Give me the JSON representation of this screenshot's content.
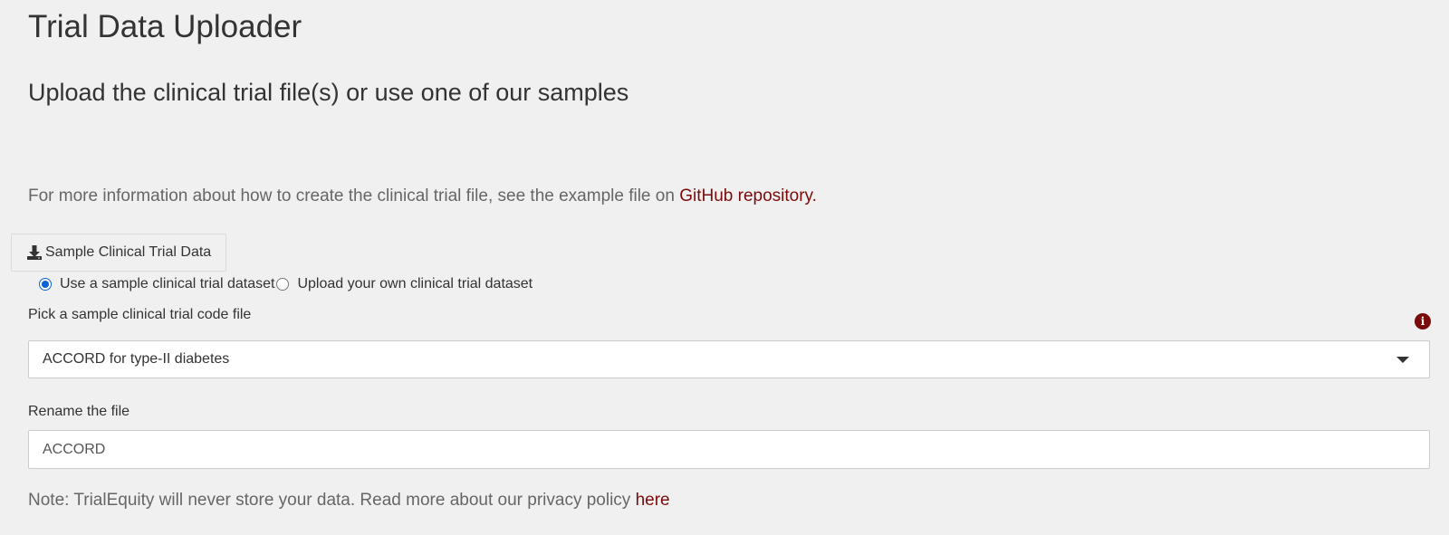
{
  "header": {
    "title": "Trial Data Uploader",
    "subtitle": "Upload the clinical trial file(s) or use one of our samples"
  },
  "info": {
    "text": "For more information about how to create the clinical trial file, see the example file on ",
    "link_text": "GitHub repository."
  },
  "download_button": {
    "label": "Sample Clinical Trial Data",
    "icon": "download-icon"
  },
  "dataset_choice": {
    "options": [
      {
        "label": "Use a sample clinical trial dataset",
        "checked": true
      },
      {
        "label": "Upload your own clinical trial dataset",
        "checked": false
      }
    ]
  },
  "sample_picker": {
    "label": "Pick a sample clinical trial code file",
    "selected": "ACCORD for type-II diabetes",
    "info_icon": "info-circle-icon"
  },
  "rename": {
    "label": "Rename the file",
    "value": "ACCORD"
  },
  "note": {
    "text": "Note: TrialEquity will never store your data. Read more about our privacy policy ",
    "link_text": "here"
  },
  "colors": {
    "background": "#f0f0f0",
    "link": "#7b0b0b",
    "radio_accent": "#0b63d6"
  }
}
